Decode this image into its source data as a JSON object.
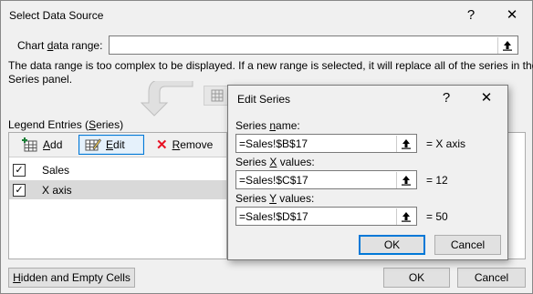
{
  "window": {
    "title": "Select Data Source",
    "help": "?",
    "close": "✕"
  },
  "chart_range": {
    "label_pre": "Chart ",
    "label_u": "d",
    "label_post": "ata range:",
    "value": ""
  },
  "message": {
    "line1": "The data range is too complex to be displayed. If a new range is selected, it will replace all of the series in the",
    "line2": "Series panel."
  },
  "legend": {
    "header_pre": "Legend Entries (",
    "header_u": "S",
    "header_post": "eries)",
    "add_u": "A",
    "add_post": "dd",
    "edit_u": "E",
    "edit_post": "dit",
    "remove_u": "R",
    "remove_post": "emove",
    "items": [
      {
        "label": "Sales",
        "checked": "✓"
      },
      {
        "label": "X axis",
        "checked": "✓"
      }
    ]
  },
  "footer": {
    "hidden_pre": "",
    "hidden_u": "H",
    "hidden_post": "idden and Empty Cells",
    "ok": "OK",
    "cancel": "Cancel"
  },
  "edit_series": {
    "title": "Edit Series",
    "help": "?",
    "close": "✕",
    "name_label_pre": "Series ",
    "name_label_u": "n",
    "name_label_post": "ame:",
    "name_value": "=Sales!$B$17",
    "name_preview": "= X axis",
    "x_label_pre": "Series ",
    "x_label_u": "X",
    "x_label_post": " values:",
    "x_value": "=Sales!$C$17",
    "x_preview": "= 12",
    "y_label_pre": "Series ",
    "y_label_u": "Y",
    "y_label_post": " values:",
    "y_value": "=Sales!$D$17",
    "y_preview": "= 50",
    "ok": "OK",
    "cancel": "Cancel"
  },
  "colors": {
    "accent": "#0078d7",
    "remove_icon": "#e81123",
    "selected_row": "#d9d9d9"
  }
}
